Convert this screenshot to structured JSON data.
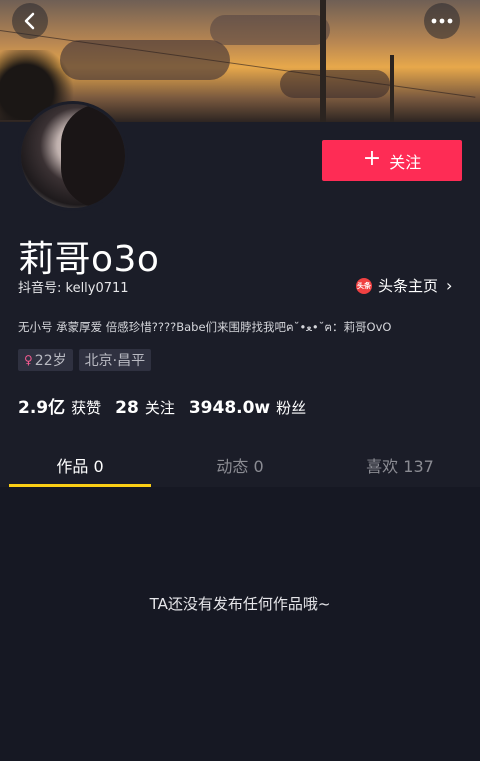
{
  "profile": {
    "name": "莉哥o3o",
    "douyin_id": "抖音号: kelly0711",
    "toutiao_label": "头条主页",
    "toutiao_logo": "头条",
    "bio": "无小号 承蒙厚爱 倍感珍惜????Babe们来围脖找我吧ฅ˘•ﻌ•˘ฅ：莉哥OvO",
    "tags": {
      "age": "22岁",
      "location": "北京·昌平"
    }
  },
  "follow_button": {
    "label": "关注",
    "icon": "plus-icon"
  },
  "stats": [
    {
      "num": "2.9亿",
      "label": "获赞"
    },
    {
      "num": "28",
      "label": "关注"
    },
    {
      "num": "3948.0w",
      "label": "粉丝"
    }
  ],
  "tabs": [
    {
      "label": "作品 0",
      "active": true
    },
    {
      "label": "动态 0",
      "active": false
    },
    {
      "label": "喜欢 137",
      "active": false
    }
  ],
  "empty_message": "TA还没有发布任何作品哦~",
  "colors": {
    "accent": "#fe2c55",
    "tab_indicator": "#face15",
    "background": "#161823"
  }
}
